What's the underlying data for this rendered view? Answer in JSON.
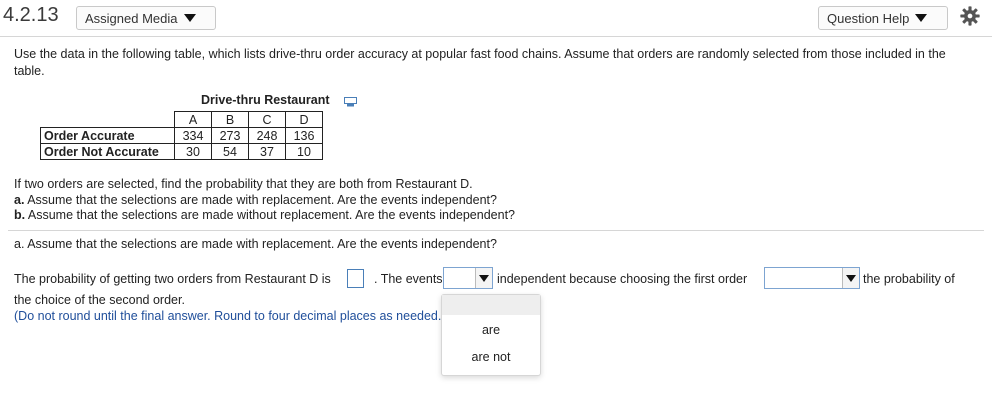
{
  "header": {
    "number": "4.2.13",
    "assigned_media": "Assigned Media",
    "question_help": "Question Help"
  },
  "question": {
    "intro": "Use the data in the following table, which lists drive-thru order accuracy at popular fast food chains. Assume that orders are randomly selected from those included in the table.",
    "table": {
      "title": "Drive-thru Restaurant",
      "columns": [
        "A",
        "B",
        "C",
        "D"
      ],
      "rows": [
        {
          "label": "Order Accurate",
          "values": [
            "334",
            "273",
            "248",
            "136"
          ]
        },
        {
          "label": "Order Not Accurate",
          "values": [
            "30",
            "54",
            "37",
            "10"
          ]
        }
      ]
    },
    "prompt": "If two orders are selected, find the probability that they are both from Restaurant D.",
    "part_a_label": "a.",
    "part_a_text": " Assume that the selections are made with replacement. Are the events independent?",
    "part_b_label": "b.",
    "part_b_text": " Assume that the selections are made without replacement. Are the events independent?"
  },
  "answer": {
    "heading": "a. Assume that the selections are made with replacement. Are the events independent?",
    "text1": "The probability of getting two orders from Restaurant D is",
    "text2": ". The events",
    "text3": "independent because choosing the first order",
    "text4": "the probability of",
    "text5": "the choice of the second order.",
    "note": "(Do not round until the final answer. Round to four decimal places as needed.)",
    "options": [
      "are",
      "are not"
    ]
  }
}
